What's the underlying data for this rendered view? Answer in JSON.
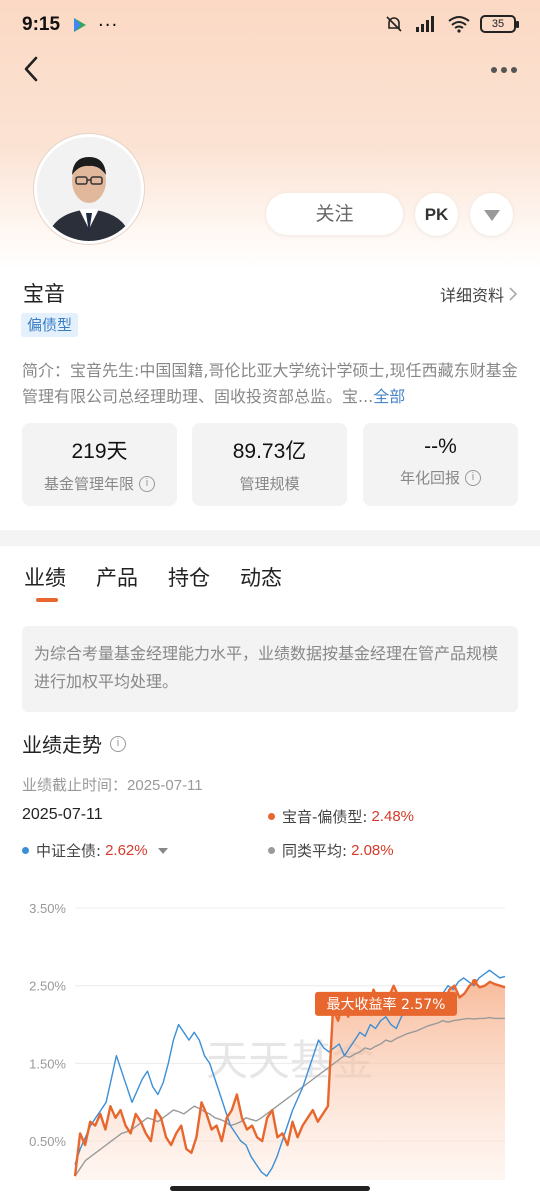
{
  "status_bar": {
    "time": "9:15",
    "battery": "35"
  },
  "header": {
    "follow_label": "关注",
    "pk_label": "PK"
  },
  "manager": {
    "name": "宝音",
    "detail_link": "详细资料",
    "type_tag": "偏债型",
    "intro_label": "简介：",
    "intro_text": "宝音先生:中国国籍,哥伦比亚大学统计学硕士,现任西藏东财基金管理有限公司总经理助理、固收投资部总监。宝...",
    "intro_more": "全部"
  },
  "stats": [
    {
      "value": "219天",
      "label": "基金管理年限"
    },
    {
      "value": "89.73亿",
      "label": "管理规模"
    },
    {
      "value": "--%",
      "label": "年化回报"
    }
  ],
  "tabs": [
    "业绩",
    "产品",
    "持仓",
    "动态"
  ],
  "notice": "为综合考量基金经理能力水平，业绩数据按基金经理在管产品规模进行加权平均处理。",
  "performance": {
    "title": "业绩走势",
    "as_of_label": "业绩截止时间：",
    "as_of_date": "2025-07-11",
    "legend_date": "2025-07-11",
    "legend": [
      {
        "name": "宝音-偏债型:",
        "value": "2.48%",
        "color": "#e8672e"
      },
      {
        "name": "中证全债:",
        "value": "2.62%",
        "color": "#3b8fd6"
      },
      {
        "name": "同类平均:",
        "value": "2.08%",
        "color": "#9a9a9a"
      }
    ]
  },
  "chart_data": {
    "type": "line",
    "y_ticks": [
      "3.50%",
      "2.50%",
      "1.50%",
      "0.50%"
    ],
    "ylim": [
      0,
      3.5
    ],
    "annotation": "最大收益率 2.57%",
    "watermark": "天天基金",
    "series": [
      {
        "name": "宝音-偏债型",
        "color": "#e8672e",
        "values": [
          0.05,
          0.6,
          0.45,
          0.75,
          0.7,
          0.85,
          0.65,
          0.95,
          0.8,
          0.9,
          0.7,
          0.6,
          0.85,
          0.75,
          0.6,
          0.5,
          0.9,
          0.8,
          0.55,
          0.45,
          0.6,
          0.7,
          0.4,
          0.35,
          0.55,
          1.0,
          0.85,
          0.65,
          0.7,
          0.5,
          0.8,
          0.9,
          1.1,
          0.8,
          0.65,
          0.7,
          0.55,
          0.5,
          0.8,
          0.9,
          0.55,
          0.6,
          0.45,
          0.75,
          0.55,
          0.7,
          0.8,
          0.9,
          0.75,
          0.85,
          0.95,
          2.2,
          2.05,
          2.3,
          2.1,
          2.4,
          2.25,
          2.35,
          2.2,
          2.45,
          2.3,
          2.4,
          2.35,
          2.5,
          2.35,
          2.3,
          2.4,
          2.2,
          2.3,
          2.25,
          2.35,
          2.4,
          2.2,
          2.3,
          2.45,
          2.5,
          2.35,
          2.4,
          2.5,
          2.55,
          2.48,
          2.5,
          2.55,
          2.52,
          2.5,
          2.48
        ]
      },
      {
        "name": "中证全债",
        "color": "#3b8fd6",
        "values": [
          0.2,
          0.4,
          0.55,
          0.7,
          0.8,
          0.9,
          1.0,
          1.3,
          1.6,
          1.4,
          1.2,
          1.0,
          1.15,
          1.3,
          1.4,
          1.2,
          1.1,
          1.25,
          1.5,
          1.8,
          2.0,
          1.9,
          1.8,
          1.9,
          1.8,
          1.6,
          1.5,
          1.3,
          1.1,
          0.9,
          0.7,
          0.6,
          0.5,
          0.45,
          0.3,
          0.2,
          0.1,
          0.05,
          0.15,
          0.3,
          0.5,
          0.7,
          0.9,
          1.05,
          1.2,
          1.4,
          1.6,
          1.8,
          1.7,
          1.65,
          1.7,
          1.75,
          1.6,
          1.7,
          1.8,
          1.9,
          1.85,
          2.0,
          1.95,
          2.05,
          2.1,
          2.0,
          1.95,
          2.1,
          2.2,
          2.15,
          2.2,
          2.3,
          2.25,
          2.3,
          2.35,
          2.4,
          2.5,
          2.45,
          2.55,
          2.6,
          2.55,
          2.5,
          2.6,
          2.65,
          2.7,
          2.65,
          2.6,
          2.62
        ]
      },
      {
        "name": "同类平均",
        "color": "#9a9a9a",
        "values": [
          0.05,
          0.15,
          0.25,
          0.3,
          0.35,
          0.4,
          0.45,
          0.5,
          0.55,
          0.6,
          0.62,
          0.65,
          0.7,
          0.75,
          0.8,
          0.78,
          0.75,
          0.8,
          0.85,
          0.9,
          0.88,
          0.85,
          0.9,
          0.95,
          0.92,
          0.88,
          0.85,
          0.8,
          0.78,
          0.75,
          0.7,
          0.72,
          0.75,
          0.8,
          0.78,
          0.76,
          0.8,
          0.85,
          0.9,
          0.95,
          1.0,
          1.05,
          1.1,
          1.15,
          1.2,
          1.25,
          1.3,
          1.35,
          1.4,
          1.45,
          1.5,
          1.55,
          1.6,
          1.58,
          1.62,
          1.65,
          1.7,
          1.68,
          1.72,
          1.75,
          1.8,
          1.78,
          1.82,
          1.85,
          1.88,
          1.9,
          1.92,
          1.95,
          1.98,
          2.0,
          2.02,
          2.05,
          2.03,
          2.05,
          2.06,
          2.07,
          2.08,
          2.07,
          2.08,
          2.08,
          2.09,
          2.08,
          2.08,
          2.08
        ]
      }
    ]
  }
}
